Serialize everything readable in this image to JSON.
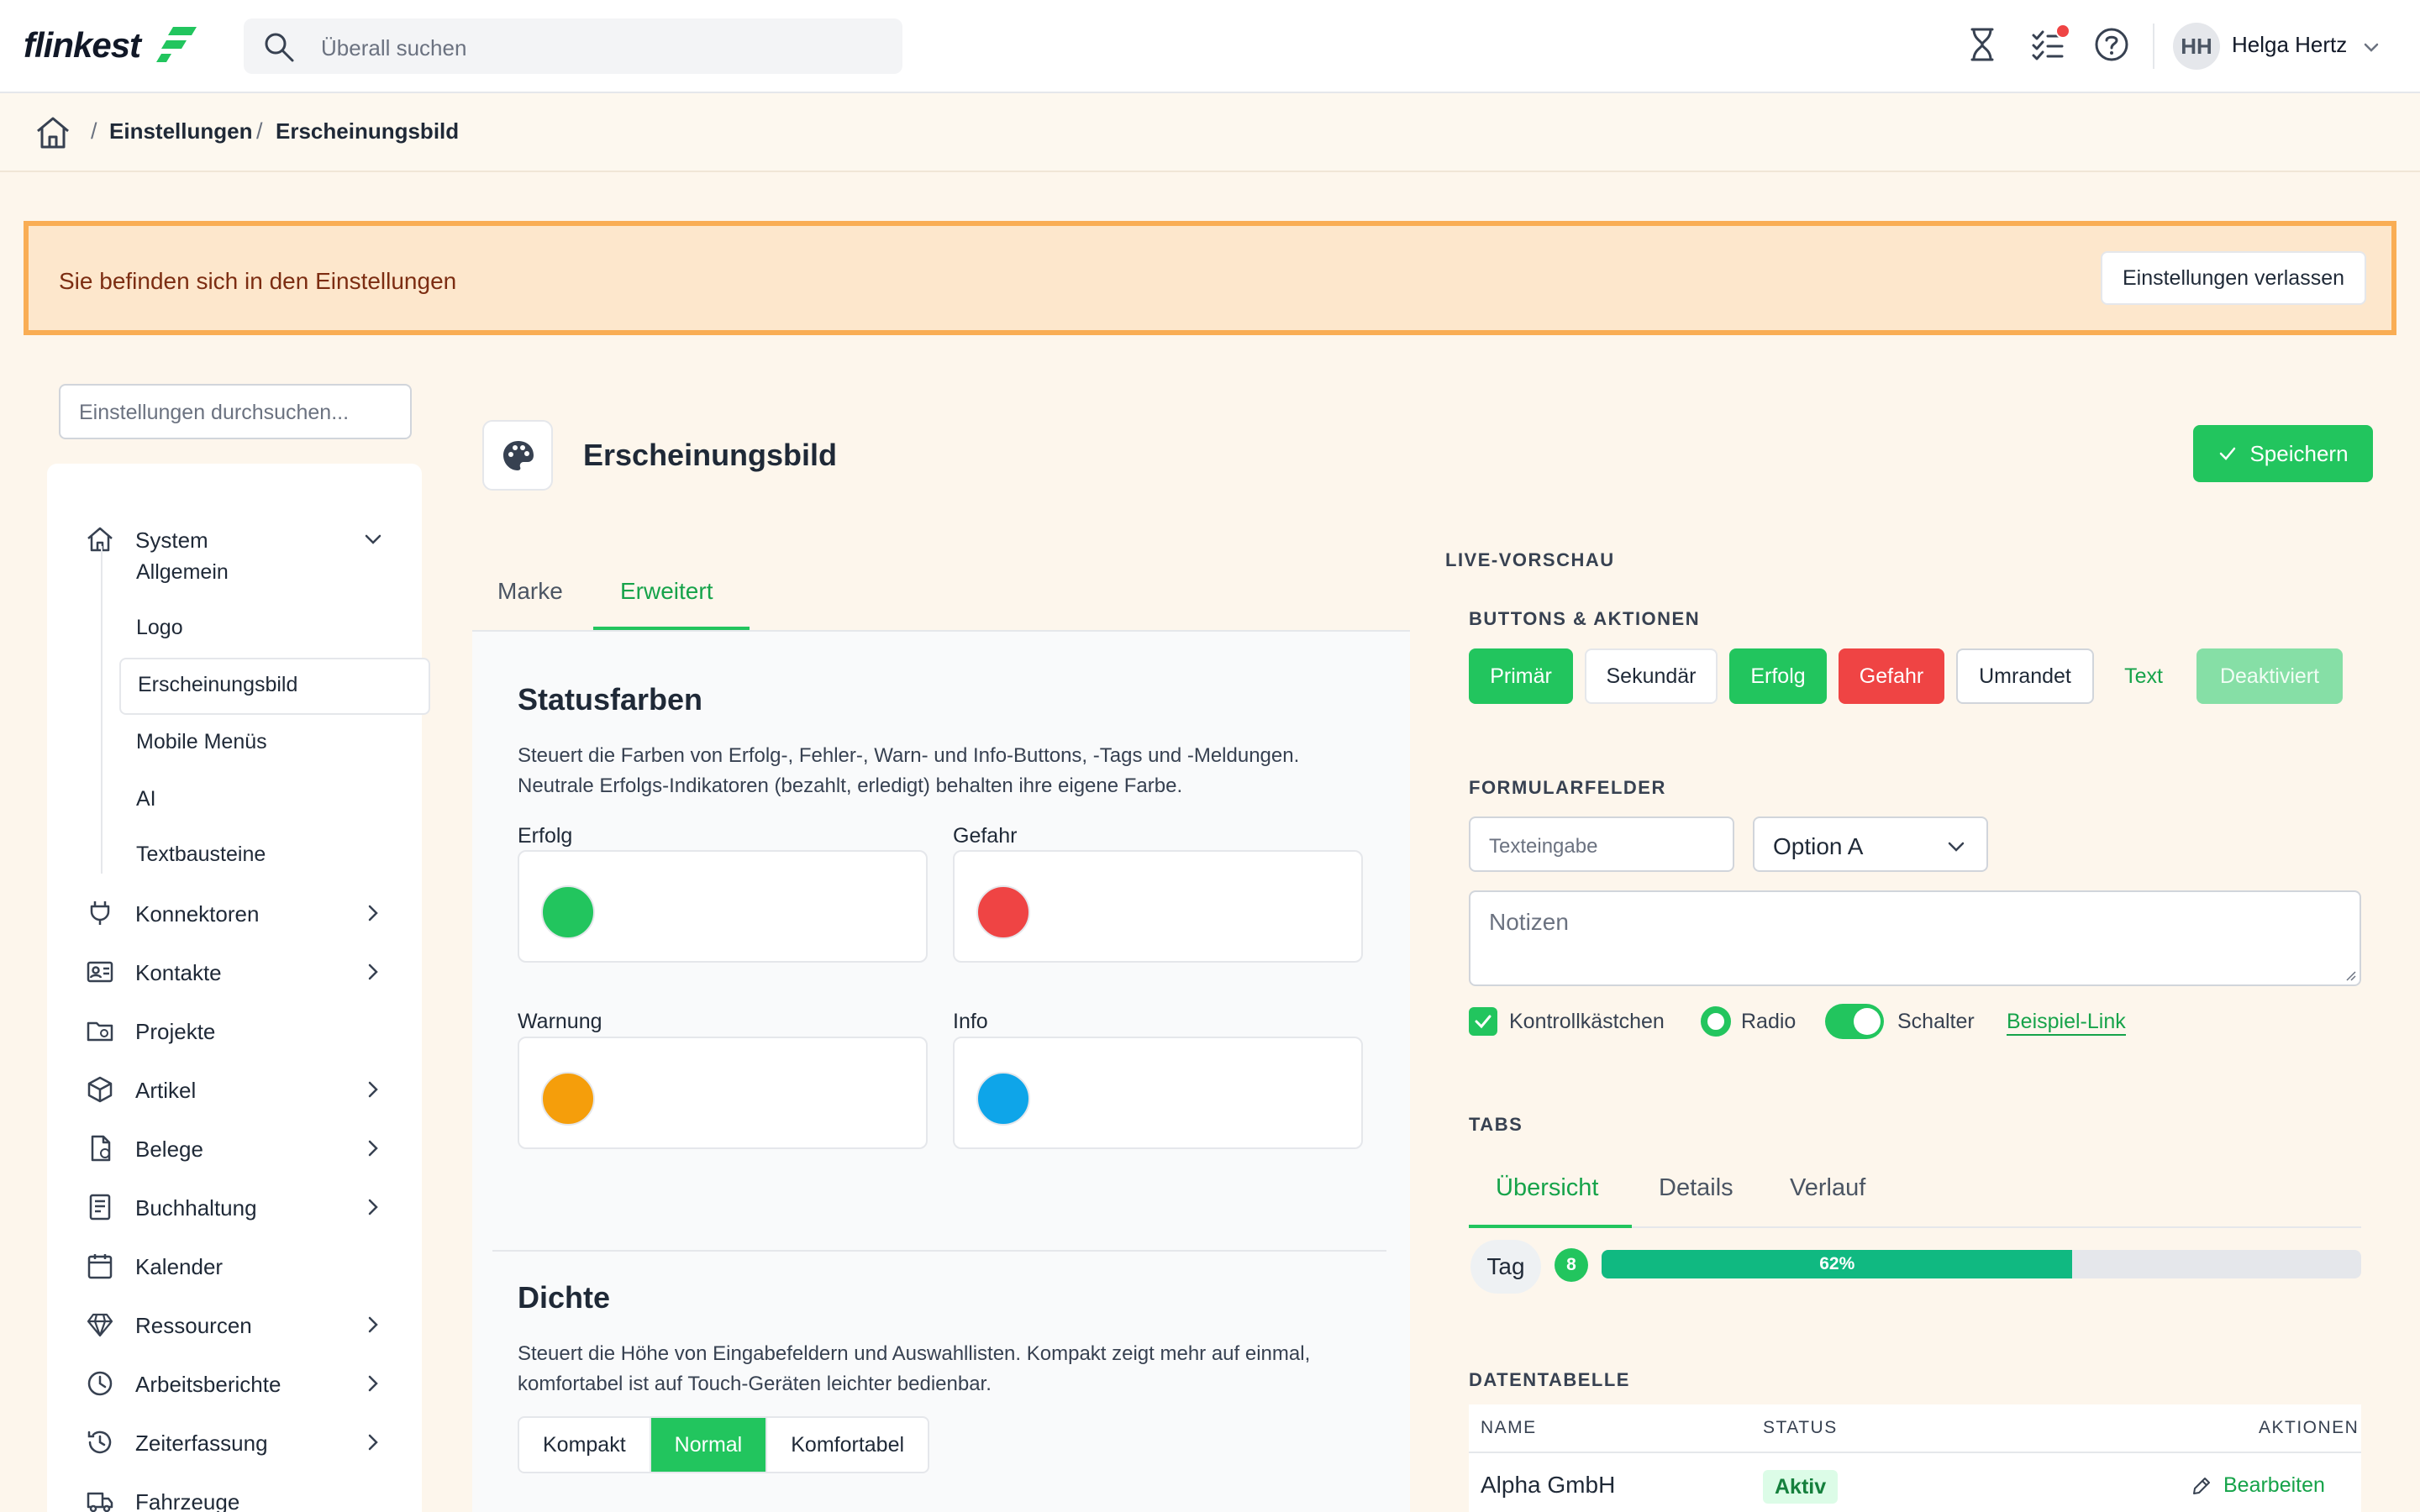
{
  "app": {
    "logo_text": "flinkest",
    "search_placeholder": "Überall suchen",
    "user_initials": "HH",
    "user_name": "Helga Hertz"
  },
  "breadcrumb": {
    "items": [
      "Einstellungen",
      "Erscheinungsbild"
    ]
  },
  "banner": {
    "message": "Sie befinden sich in den Einstellungen",
    "exit_label": "Einstellungen verlassen"
  },
  "sidebar": {
    "search_placeholder": "Einstellungen durchsuchen...",
    "items": [
      {
        "label": "System",
        "icon": "home-icon",
        "expandable": true,
        "expanded": true
      },
      {
        "label": "Konnektoren",
        "icon": "plug-icon",
        "expandable": true
      },
      {
        "label": "Kontakte",
        "icon": "contact-card-icon",
        "expandable": true
      },
      {
        "label": "Projekte",
        "icon": "folder-icon",
        "expandable": false
      },
      {
        "label": "Artikel",
        "icon": "box-icon",
        "expandable": true
      },
      {
        "label": "Belege",
        "icon": "document-icon",
        "expandable": true
      },
      {
        "label": "Buchhaltung",
        "icon": "ledger-icon",
        "expandable": true
      },
      {
        "label": "Kalender",
        "icon": "calendar-icon",
        "expandable": false
      },
      {
        "label": "Ressourcen",
        "icon": "diamond-icon",
        "expandable": true
      },
      {
        "label": "Arbeitsberichte",
        "icon": "clock-icon",
        "expandable": true
      },
      {
        "label": "Zeiterfassung",
        "icon": "history-icon",
        "expandable": true
      },
      {
        "label": "Fahrzeuge",
        "icon": "truck-icon",
        "expandable": false
      }
    ],
    "system_children": [
      "Allgemein",
      "Logo",
      "Erscheinungsbild",
      "Mobile Menüs",
      "AI",
      "Textbausteine"
    ],
    "active_child": "Erscheinungsbild"
  },
  "page": {
    "title": "Erscheinungsbild",
    "save_label": "Speichern",
    "tabs": [
      "Marke",
      "Erweitert"
    ],
    "active_tab": "Erweitert"
  },
  "status_colors": {
    "title": "Statusfarben",
    "description": "Steuert die Farben von Erfolg-, Fehler-, Warn- und Info-Buttons, -Tags und -Meldungen. Neutrale Erfolgs-Indikatoren (bezahlt, erledigt) behalten ihre eigene Farbe.",
    "fields": [
      {
        "label": "Erfolg",
        "color": "#22c55e"
      },
      {
        "label": "Gefahr",
        "color": "#ef4444"
      },
      {
        "label": "Warnung",
        "color": "#f59e0b"
      },
      {
        "label": "Info",
        "color": "#0ea5e9"
      }
    ]
  },
  "density": {
    "title": "Dichte",
    "description": "Steuert die Höhe von Eingabefeldern und Auswahllisten. Kompakt zeigt mehr auf einmal, komfortabel ist auf Touch-Geräten leichter bedienbar.",
    "options": [
      "Kompakt",
      "Normal",
      "Komfortabel"
    ],
    "selected": "Normal"
  },
  "preview": {
    "heading": "LIVE-VORSCHAU",
    "buttons_heading": "BUTTONS & AKTIONEN",
    "buttons": [
      "Primär",
      "Sekundär",
      "Erfolg",
      "Gefahr",
      "Umrandet",
      "Text",
      "Deaktiviert"
    ],
    "forms_heading": "FORMULARFELDER",
    "text_placeholder": "Texteingabe",
    "select_value": "Option A",
    "textarea_placeholder": "Notizen",
    "checkbox_label": "Kontrollkästchen",
    "radio_label": "Radio",
    "switch_label": "Schalter",
    "link_label": "Beispiel-Link",
    "tabs_heading": "TABS",
    "tabs": [
      "Übersicht",
      "Details",
      "Verlauf"
    ],
    "active_tab": "Übersicht",
    "tag_label": "Tag",
    "badge_count": "8",
    "progress_value": 62,
    "progress_label": "62%",
    "table_heading": "DATENTABELLE",
    "table_columns": [
      "NAME",
      "STATUS",
      "AKTIONEN"
    ],
    "table_rows": [
      {
        "name": "Alpha GmbH",
        "status": "Aktiv",
        "action": "Bearbeiten"
      }
    ]
  },
  "colors": {
    "accent": "#22c55e",
    "danger": "#ef4444",
    "banner_bg": "#fde7cc",
    "banner_border": "#f9ad54"
  }
}
